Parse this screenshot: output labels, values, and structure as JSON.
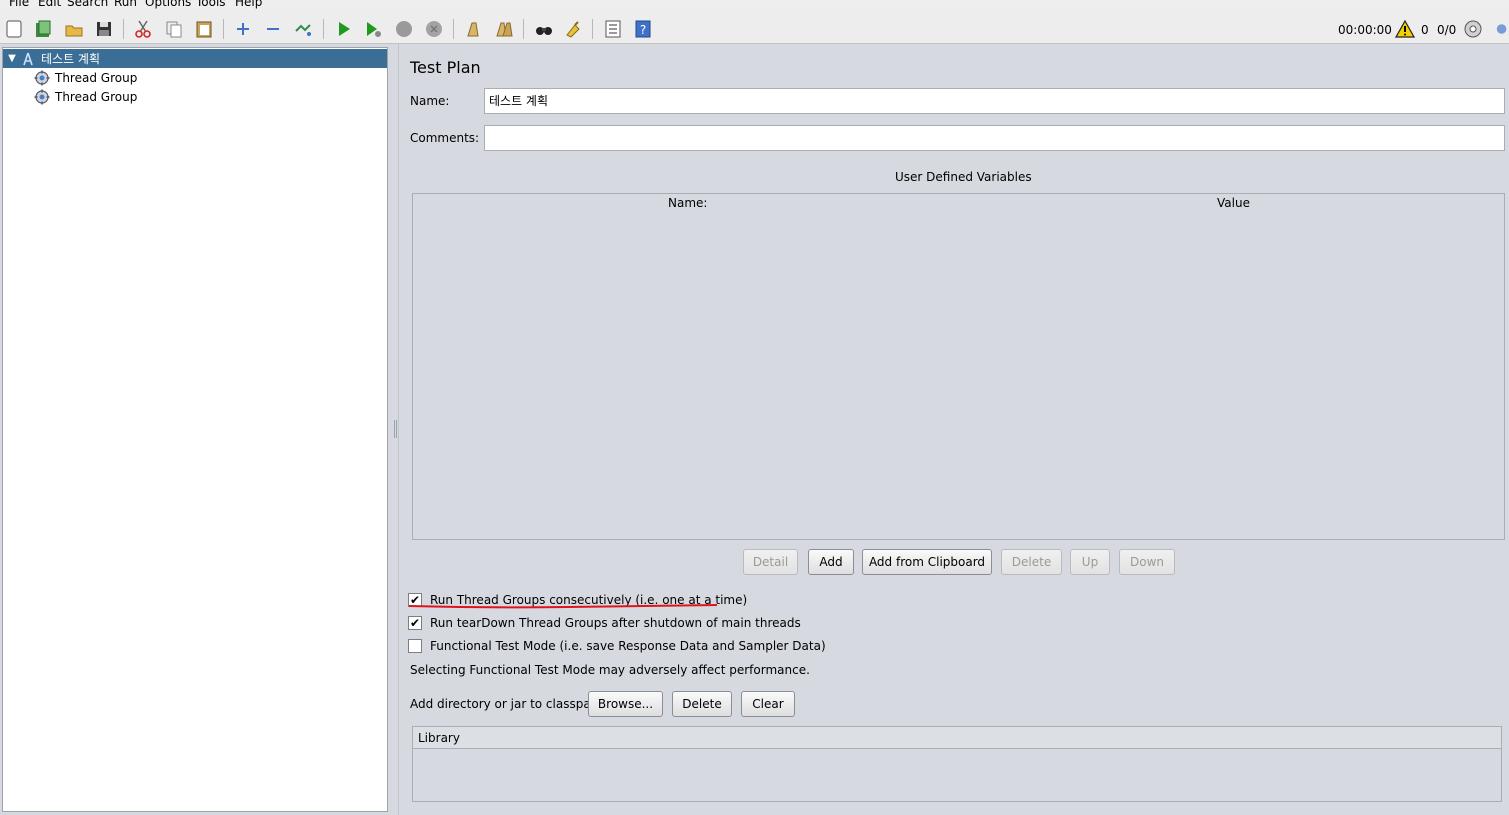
{
  "menubar": {
    "items": [
      "File",
      "Edit",
      "Search",
      "Run",
      "Options",
      "Tools",
      "Help"
    ]
  },
  "toolbar": {
    "icons": [
      "new-icon",
      "templates-icon",
      "open-icon",
      "save-icon",
      "cut-icon",
      "copy-icon",
      "paste-icon",
      "expand-icon",
      "collapse-icon",
      "toggle-icon",
      "start-icon",
      "start-no-pauses-icon",
      "stop-icon",
      "shutdown-icon",
      "clear-icon",
      "clear-all-icon",
      "search-icon",
      "reset-search-icon",
      "function-helper-icon",
      "help-icon"
    ],
    "timer": "00:00:00",
    "warning_count": "0",
    "threads": "0/0"
  },
  "tree": {
    "items": [
      {
        "label": "테스트 계획",
        "icon": "test-plan-icon",
        "selected": true
      },
      {
        "label": "Thread Group",
        "icon": "thread-group-gear-icon",
        "selected": false
      },
      {
        "label": "Thread Group",
        "icon": "thread-group-gear-icon",
        "selected": false
      }
    ]
  },
  "main": {
    "title": "Test Plan",
    "name_label": "Name:",
    "name_value": "테스트 계획",
    "comments_label": "Comments:",
    "comments_value": "",
    "udv_title": "User Defined Variables",
    "udv_columns": [
      "Name:",
      "Value"
    ],
    "udv_buttons": [
      {
        "label": "Detail",
        "enabled": false
      },
      {
        "label": "Add",
        "enabled": true
      },
      {
        "label": "Add from Clipboard",
        "enabled": true
      },
      {
        "label": "Delete",
        "enabled": false
      },
      {
        "label": "Up",
        "enabled": false
      },
      {
        "label": "Down",
        "enabled": false
      }
    ],
    "checkboxes": [
      {
        "label": "Run Thread Groups consecutively (i.e. one at a time)",
        "checked": true
      },
      {
        "label": "Run tearDown Thread Groups after shutdown of main threads",
        "checked": true
      },
      {
        "label": "Functional Test Mode (i.e. save Response Data and Sampler Data)",
        "checked": false
      }
    ],
    "functional_warning": "Selecting Functional Test Mode may adversely affect performance.",
    "classpath_label": "Add directory or jar to classpath",
    "classpath_buttons": [
      "Browse...",
      "Delete",
      "Clear"
    ],
    "library_column": "Library"
  },
  "colors": {
    "selection": "#3b6e96",
    "annotation": "#e0141e",
    "run_green": "#1f9a1f"
  }
}
